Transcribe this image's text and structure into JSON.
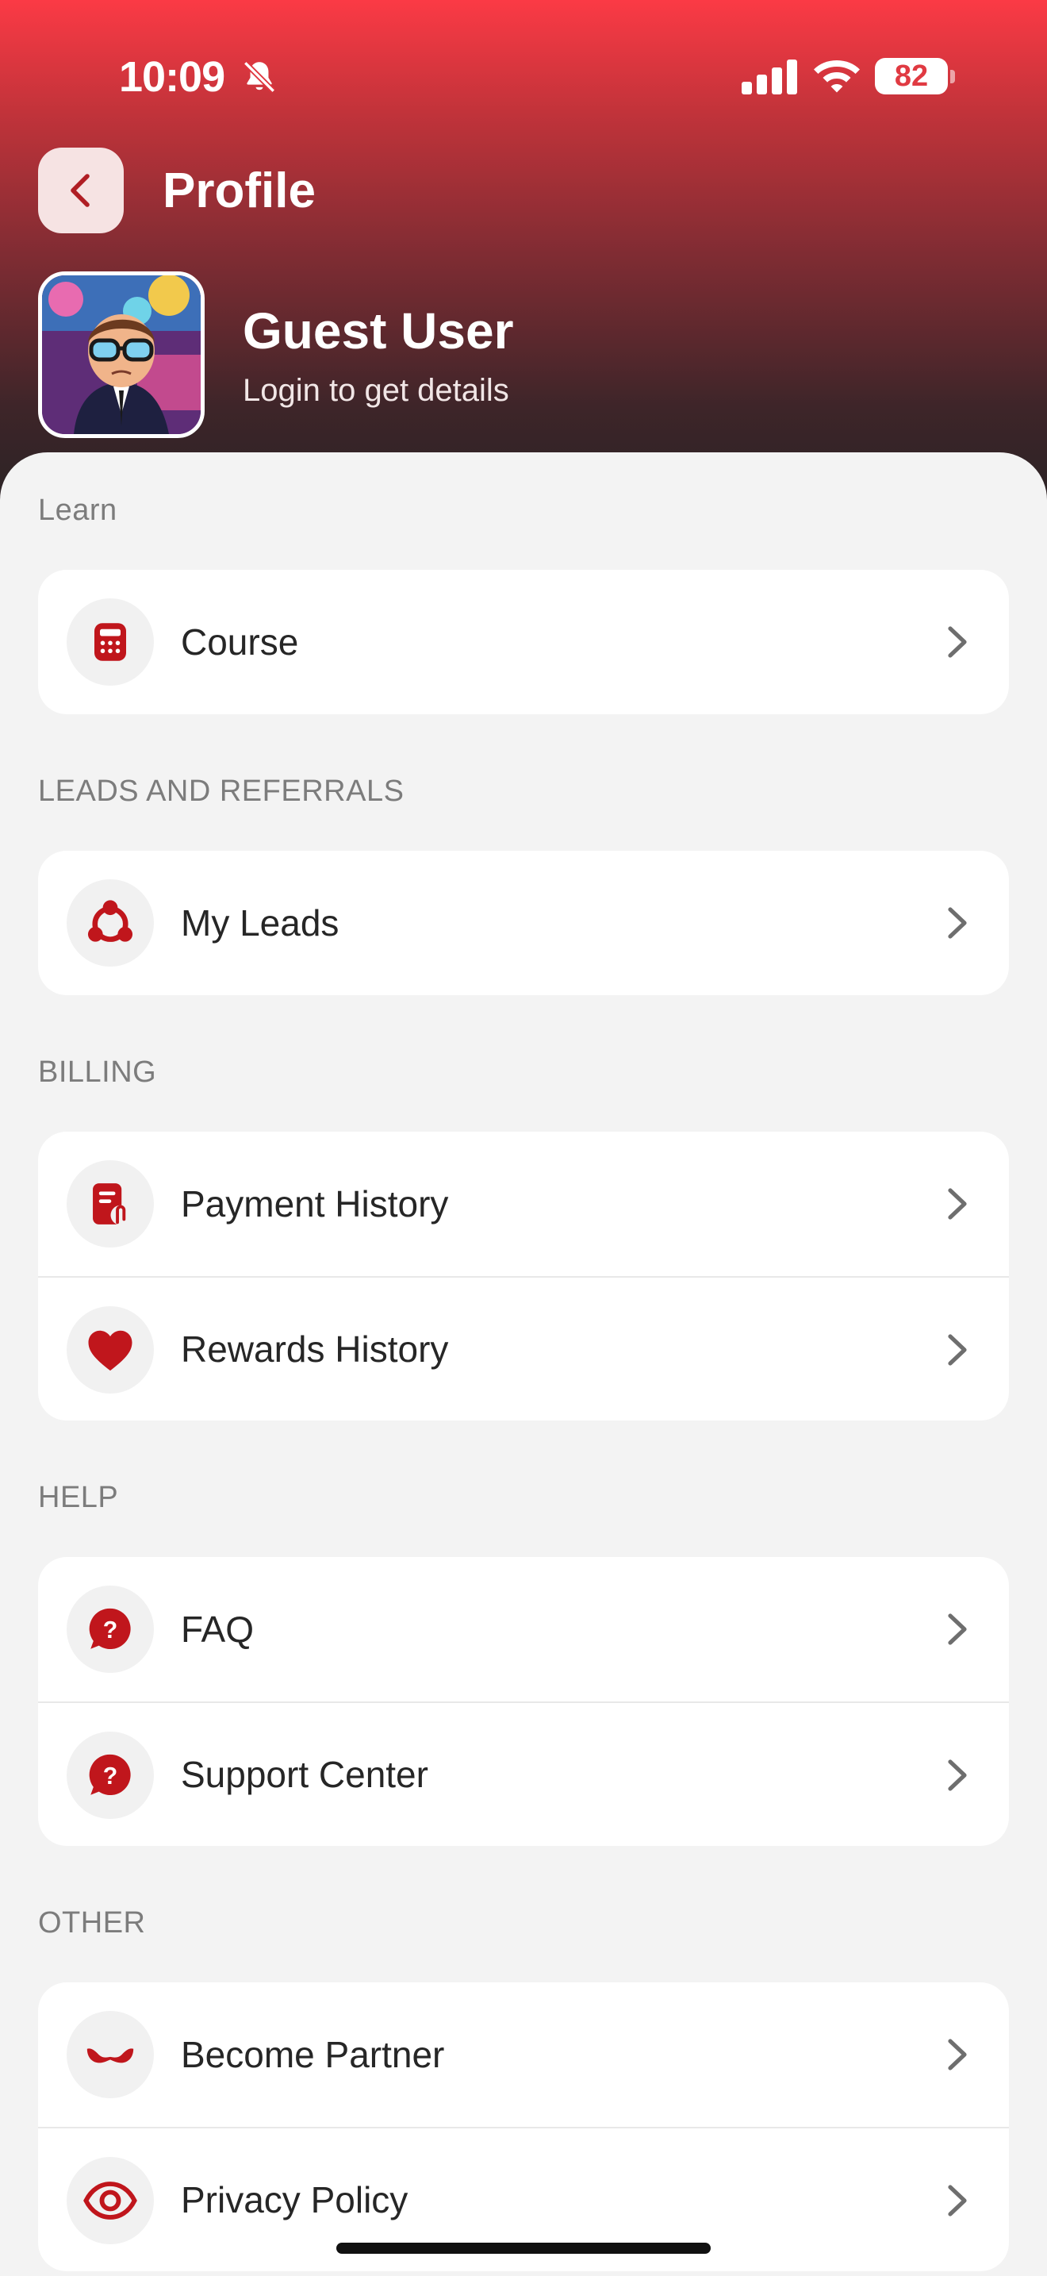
{
  "status_bar": {
    "time": "10:09",
    "battery": "82",
    "icons": [
      "bell-slash-icon",
      "signal-icon",
      "wifi-icon",
      "battery-icon"
    ]
  },
  "header": {
    "title": "Profile",
    "back_icon": "chevron-left-icon",
    "user_name": "Guest User",
    "user_subtitle": "Login to get details"
  },
  "colors": {
    "accent": "#c0161c",
    "header_top": "#fb3a45",
    "header_bottom": "#2a2325",
    "background": "#f3f3f3"
  },
  "sections": [
    {
      "label": "Learn",
      "items": [
        {
          "label": "Course",
          "icon": "calculator-icon"
        }
      ]
    },
    {
      "label": "LEADS AND REFERRALS",
      "items": [
        {
          "label": "My Leads",
          "icon": "network-icon"
        }
      ]
    },
    {
      "label": "BILLING",
      "items": [
        {
          "label": "Payment History",
          "icon": "receipt-icon"
        },
        {
          "label": "Rewards History",
          "icon": "heart-icon"
        }
      ]
    },
    {
      "label": "HELP",
      "items": [
        {
          "label": "FAQ",
          "icon": "question-bubble-icon"
        },
        {
          "label": "Support Center",
          "icon": "question-bubble-icon"
        }
      ]
    },
    {
      "label": "OTHER",
      "items": [
        {
          "label": "Become Partner",
          "icon": "handshake-icon"
        },
        {
          "label": "Privacy Policy",
          "icon": "eye-icon"
        }
      ]
    }
  ]
}
